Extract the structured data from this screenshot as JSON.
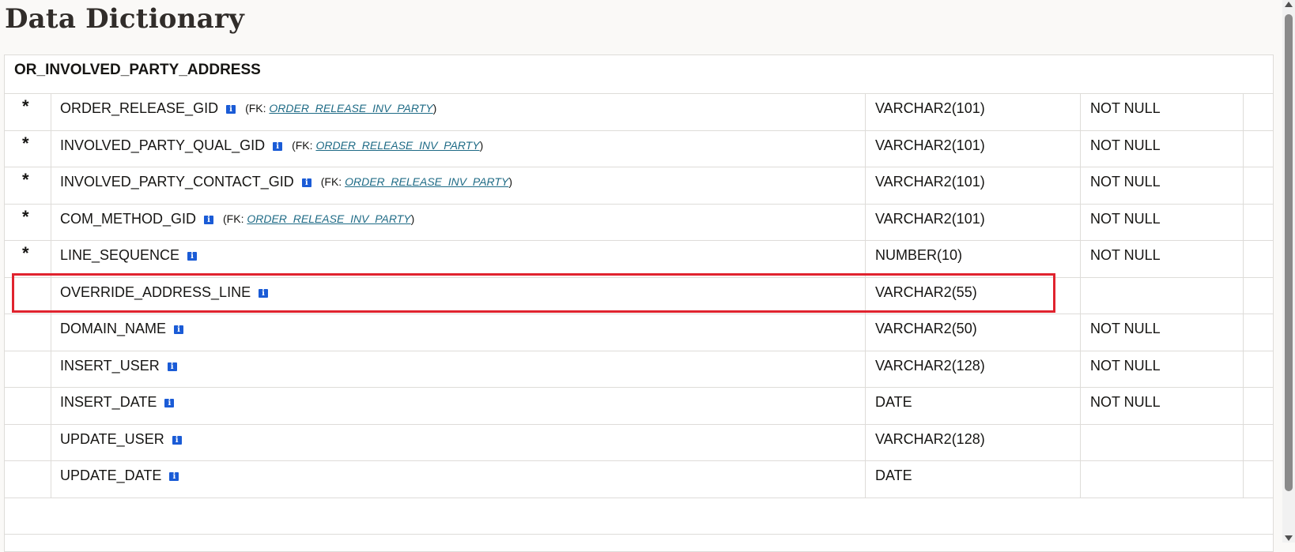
{
  "page": {
    "title": "Data Dictionary"
  },
  "table": {
    "name": "OR_INVOLVED_PARTY_ADDRESS",
    "fk_prefix": "(FK: ",
    "fk_suffix": ")",
    "columns": [
      {
        "pk": "*",
        "name": "ORDER_RELEASE_GID",
        "fk": "ORDER_RELEASE_INV_PARTY",
        "type": "VARCHAR2(101)",
        "null": "NOT NULL"
      },
      {
        "pk": "*",
        "name": "INVOLVED_PARTY_QUAL_GID",
        "fk": "ORDER_RELEASE_INV_PARTY",
        "type": "VARCHAR2(101)",
        "null": "NOT NULL"
      },
      {
        "pk": "*",
        "name": "INVOLVED_PARTY_CONTACT_GID",
        "fk": "ORDER_RELEASE_INV_PARTY",
        "type": "VARCHAR2(101)",
        "null": "NOT NULL"
      },
      {
        "pk": "*",
        "name": "COM_METHOD_GID",
        "fk": "ORDER_RELEASE_INV_PARTY",
        "type": "VARCHAR2(101)",
        "null": "NOT NULL"
      },
      {
        "pk": "*",
        "name": "LINE_SEQUENCE",
        "fk": "",
        "type": "NUMBER(10)",
        "null": "NOT NULL"
      },
      {
        "pk": "",
        "name": "OVERRIDE_ADDRESS_LINE",
        "fk": "",
        "type": "VARCHAR2(55)",
        "null": ""
      },
      {
        "pk": "",
        "name": "DOMAIN_NAME",
        "fk": "",
        "type": "VARCHAR2(50)",
        "null": "NOT NULL"
      },
      {
        "pk": "",
        "name": "INSERT_USER",
        "fk": "",
        "type": "VARCHAR2(128)",
        "null": "NOT NULL"
      },
      {
        "pk": "",
        "name": "INSERT_DATE",
        "fk": "",
        "type": "DATE",
        "null": "NOT NULL"
      },
      {
        "pk": "",
        "name": "UPDATE_USER",
        "fk": "",
        "type": "VARCHAR2(128)",
        "null": ""
      },
      {
        "pk": "",
        "name": "UPDATE_DATE",
        "fk": "",
        "type": "DATE",
        "null": ""
      }
    ]
  },
  "icons": {
    "info": "info-icon"
  },
  "colors": {
    "highlight": "#e0232e",
    "link": "#1f6b86",
    "info_icon": "#1a5bd6"
  }
}
